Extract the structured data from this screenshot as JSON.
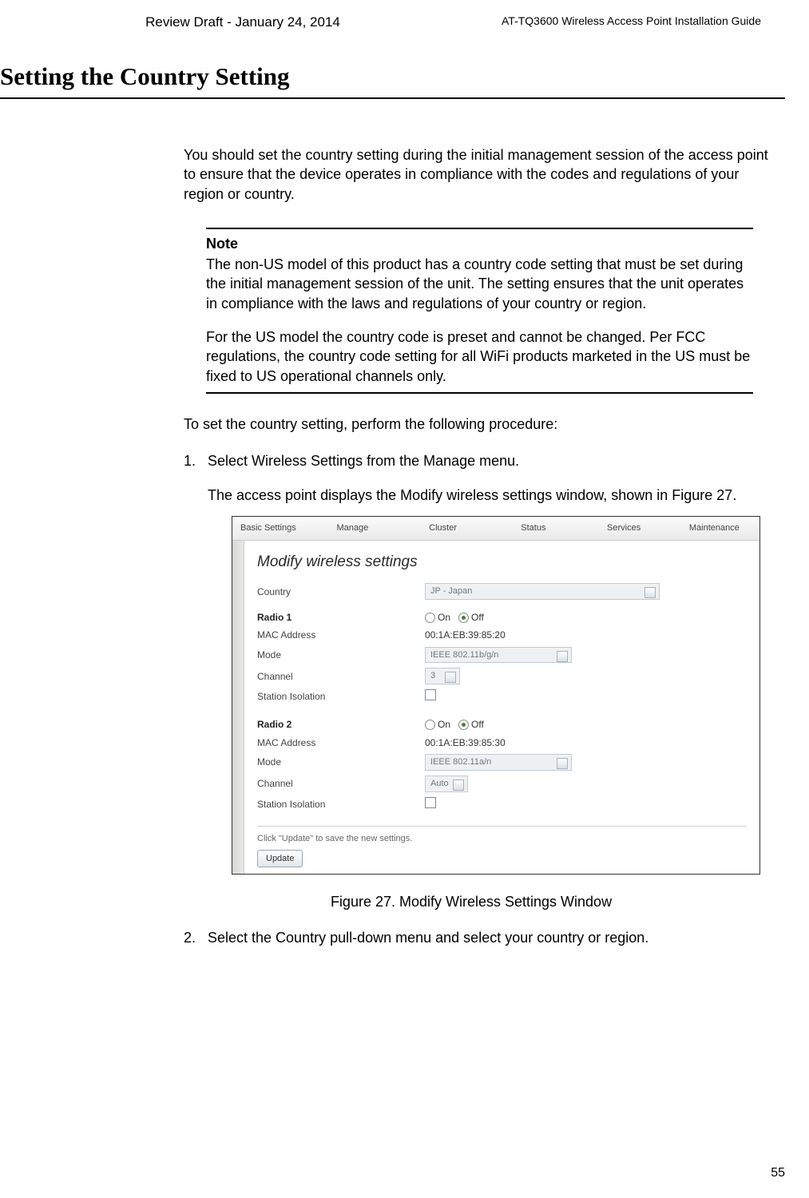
{
  "header": {
    "draft": "Review Draft - January 24, 2014",
    "guide": "AT-TQ3600 Wireless Access Point Installation Guide"
  },
  "section_title": "Setting the Country Setting",
  "intro": "You should set the country setting during the initial management session of the access point to ensure that the device operates in compliance with the codes and regulations of your region or country.",
  "note": {
    "title": "Note",
    "p1": "The non-US model of this product has a country code setting that must be set during the initial management session of the unit. The setting ensures that the unit operates in compliance with the laws and regulations of your country or region.",
    "p2": "For the US model the country code is preset and cannot be changed. Per FCC regulations, the country code setting for all WiFi products marketed in the US must be fixed to US operational channels only."
  },
  "proc_intro": "To set the country setting, perform the following procedure:",
  "steps": {
    "s1_num": "1.",
    "s1_text": "Select Wireless Settings from the Manage menu.",
    "s1_sub": "The access point displays the Modify wireless settings window, shown in Figure 27.",
    "s2_num": "2.",
    "s2_text": "Select the Country pull-down menu and select your country or region."
  },
  "figure": {
    "tabs": {
      "t0": "Basic Settings",
      "t1": "Manage",
      "t2": "Cluster",
      "t3": "Status",
      "t4": "Services",
      "t5": "Maintenance"
    },
    "title": "Modify wireless settings",
    "country_label": "Country",
    "country_value": "JP - Japan",
    "radio1": {
      "heading": "Radio 1",
      "on": "On",
      "off": "Off",
      "mac_label": "MAC Address",
      "mac_value": "00:1A:EB:39:85:20",
      "mode_label": "Mode",
      "mode_value": "IEEE 802.11b/g/n",
      "channel_label": "Channel",
      "channel_value": "3",
      "iso_label": "Station Isolation"
    },
    "radio2": {
      "heading": "Radio 2",
      "on": "On",
      "off": "Off",
      "mac_label": "MAC Address",
      "mac_value": "00:1A:EB:39:85:30",
      "mode_label": "Mode",
      "mode_value": "IEEE 802.11a/n",
      "channel_label": "Channel",
      "channel_value": "Auto",
      "iso_label": "Station Isolation"
    },
    "save_hint": "Click \"Update\" to save the new settings.",
    "update": "Update",
    "caption": "Figure 27. Modify Wireless Settings Window"
  },
  "page_number": "55"
}
